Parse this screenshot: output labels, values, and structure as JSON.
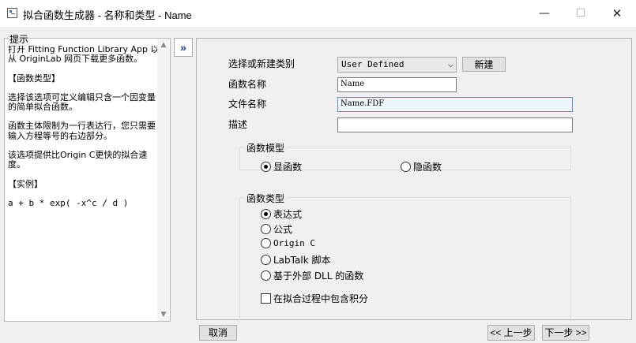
{
  "window": {
    "title": "拟合函数生成器 - 名称和类型 - Name",
    "minimize": "—",
    "maximize": "☐",
    "close": "✕"
  },
  "hint": {
    "label": "提示",
    "paragraphs": [
      "打开 Fitting Function Library App 以从 OriginLab 网页下载更多函数。",
      "【函数类型】",
      "选择该选项可定义编辑只含一个因变量的简单拟合函数。",
      "函数主体限制为一行表达行，您只需要输入方程等号的右边部分。",
      "该选项提供比Origin C更快的拟合速度。",
      "【实例】",
      "a + b * exp( -x^c / d )"
    ]
  },
  "toggle": {
    "label": "»"
  },
  "form": {
    "category_label": "选择或新建类别",
    "category_value": "User Defined",
    "new_button": "新建",
    "name_label": "函数名称",
    "name_value": "Name",
    "file_label": "文件名称",
    "file_value": "Name.FDF",
    "desc_label": "描述",
    "desc_value": "",
    "model_group": {
      "title": "函数模型",
      "options": [
        {
          "label": "显函数",
          "checked": true
        },
        {
          "label": "隐函数",
          "checked": false
        }
      ]
    },
    "type_group": {
      "title": "函数类型",
      "options": [
        {
          "label": "表达式",
          "checked": true
        },
        {
          "label": "公式",
          "checked": false
        },
        {
          "label": "Origin C",
          "checked": false
        },
        {
          "label": "LabTalk 脚本",
          "checked": false
        },
        {
          "label": "基于外部 DLL 的函数",
          "checked": false
        }
      ],
      "integral_label": "在拟合过程中包含积分",
      "integral_checked": false
    }
  },
  "footer": {
    "cancel": "取消",
    "prev": "<< 上一步",
    "next": "下一步 >>"
  }
}
